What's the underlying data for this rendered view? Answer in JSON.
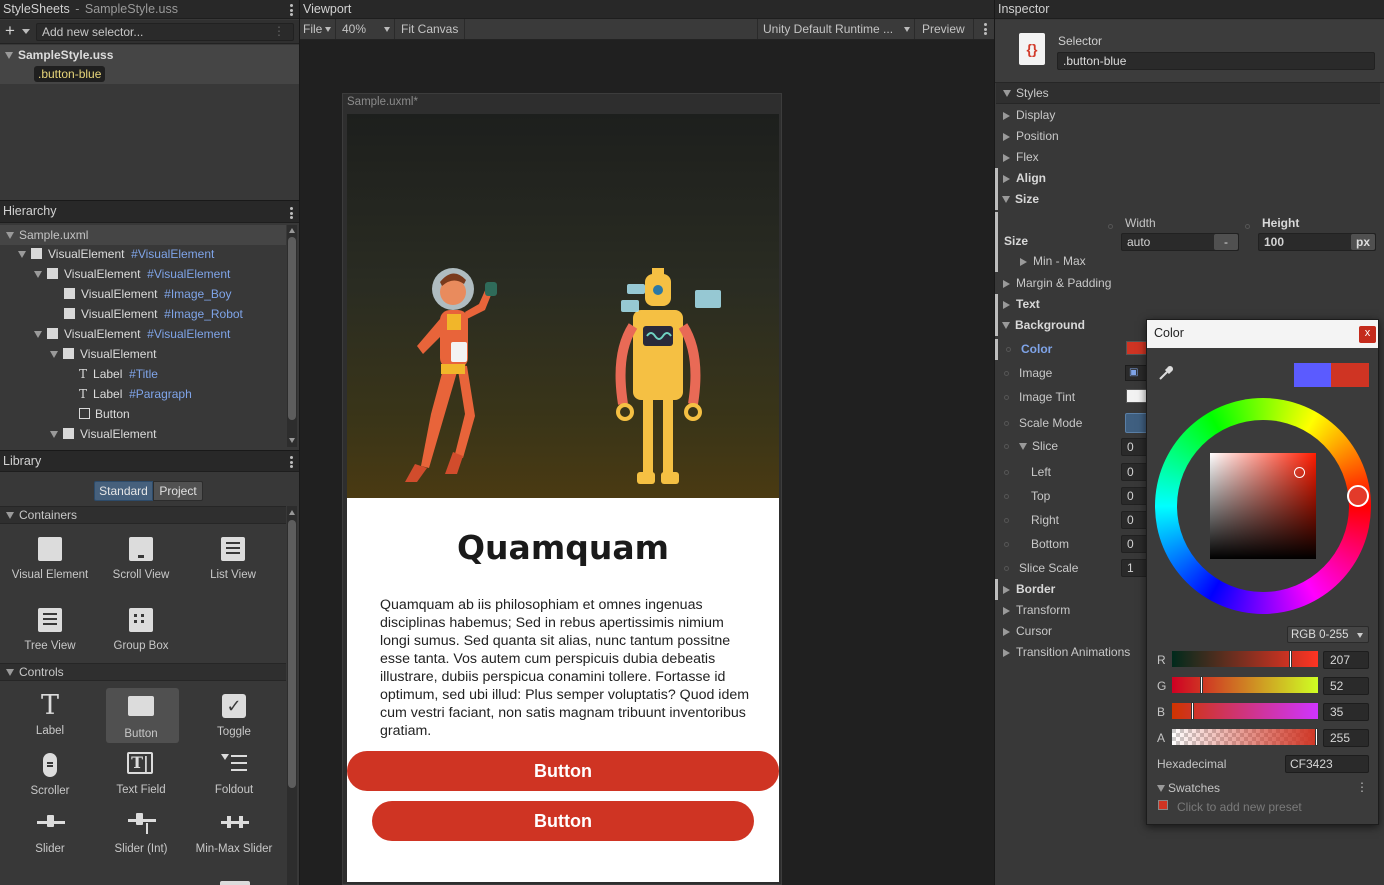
{
  "stylesheets": {
    "title": "StyleSheets",
    "separator": "-",
    "file": "SampleStyle.uss",
    "add_placeholder": "Add new selector...",
    "sheet_name": "SampleStyle.uss",
    "selector": ".button-blue"
  },
  "hierarchy": {
    "title": "Hierarchy",
    "root": "Sample.uxml",
    "items": [
      {
        "type": "VisualElement",
        "name": "#VisualElement"
      },
      {
        "type": "VisualElement",
        "name": "#VisualElement"
      },
      {
        "type": "VisualElement",
        "name": "#Image_Boy"
      },
      {
        "type": "VisualElement",
        "name": "#Image_Robot"
      },
      {
        "type": "VisualElement",
        "name": "#VisualElement"
      },
      {
        "type": "VisualElement",
        "name": ""
      },
      {
        "type": "Label",
        "name": "#Title"
      },
      {
        "type": "Label",
        "name": "#Paragraph"
      },
      {
        "type": "Button",
        "name": ""
      },
      {
        "type": "VisualElement",
        "name": ""
      }
    ]
  },
  "library": {
    "title": "Library",
    "tabs": [
      "Standard",
      "Project"
    ],
    "containers_label": "Containers",
    "containers": [
      "Visual Element",
      "Scroll View",
      "List View",
      "Tree View",
      "Group Box"
    ],
    "controls_label": "Controls",
    "controls": [
      "Label",
      "Button",
      "Toggle",
      "Scroller",
      "Text Field",
      "Foldout",
      "Slider",
      "Slider (Int)",
      "Min-Max Slider"
    ]
  },
  "viewport": {
    "title": "Viewport",
    "file_menu": "File",
    "zoom": "40%",
    "fit_canvas": "Fit Canvas",
    "theme": "Unity Default Runtime ...",
    "preview": "Preview",
    "document_title": "Sample.uxml*",
    "heading": "Quamquam",
    "paragraph": "Quamquam ab iis philosophiam et omnes ingenuas disciplinas habemus; Sed in rebus apertissimis nimium longi sumus. Sed quanta sit alias, nunc tantum possitne esse tanta. Vos autem cum perspicuis dubia debeatis illustrare, dubiis perspicua conamini tollere. Fortasse id optimum, sed ubi illud: Plus semper voluptatis? Quod idem cum vestri faciant, non satis magnam tribuunt inventoribus gratiam.",
    "button1": "Button",
    "button2": "Button"
  },
  "inspector": {
    "title": "Inspector",
    "selector_label": "Selector",
    "selector_value": ".button-blue",
    "styles_label": "Styles",
    "display": "Display",
    "position": "Position",
    "flex": "Flex",
    "align": "Align",
    "size": "Size",
    "width_label": "Width",
    "height_label": "Height",
    "size_row_label": "Size",
    "width_value": "auto",
    "width_unit": "-",
    "height_value": "100",
    "height_unit": "px",
    "min_max": "Min - Max",
    "margin_padding": "Margin & Padding",
    "text": "Text",
    "background": "Background",
    "bg_color": "Color",
    "bg_image": "Image",
    "bg_image_tint": "Image Tint",
    "bg_scale_mode": "Scale Mode",
    "bg_slice": "Slice",
    "slice_value": "0",
    "slice_left": "Left",
    "slice_top": "Top",
    "slice_right": "Right",
    "slice_bottom": "Bottom",
    "slice_left_value": "0",
    "slice_top_value": "0",
    "slice_right_value": "0",
    "slice_bottom_value": "0",
    "slice_scale": "Slice Scale",
    "slice_scale_value": "1",
    "border": "Border",
    "transform": "Transform",
    "cursor": "Cursor",
    "transition_animations": "Transition Animations"
  },
  "color_picker": {
    "title": "Color",
    "close": "x",
    "mode": "RGB 0-255",
    "r_label": "R",
    "r": "207",
    "r_fraction": 0.81,
    "g_label": "G",
    "g": "52",
    "g_fraction": 0.2,
    "b_label": "B",
    "b": "35",
    "b_fraction": 0.14,
    "a_label": "A",
    "a": "255",
    "a_fraction": 1.0,
    "hex_label": "Hexadecimal",
    "hex": "CF3423",
    "swatches_label": "Swatches",
    "add_preset": "Click to add new preset",
    "previous_color": "#5b5bff",
    "current_color": "#cf3423"
  }
}
